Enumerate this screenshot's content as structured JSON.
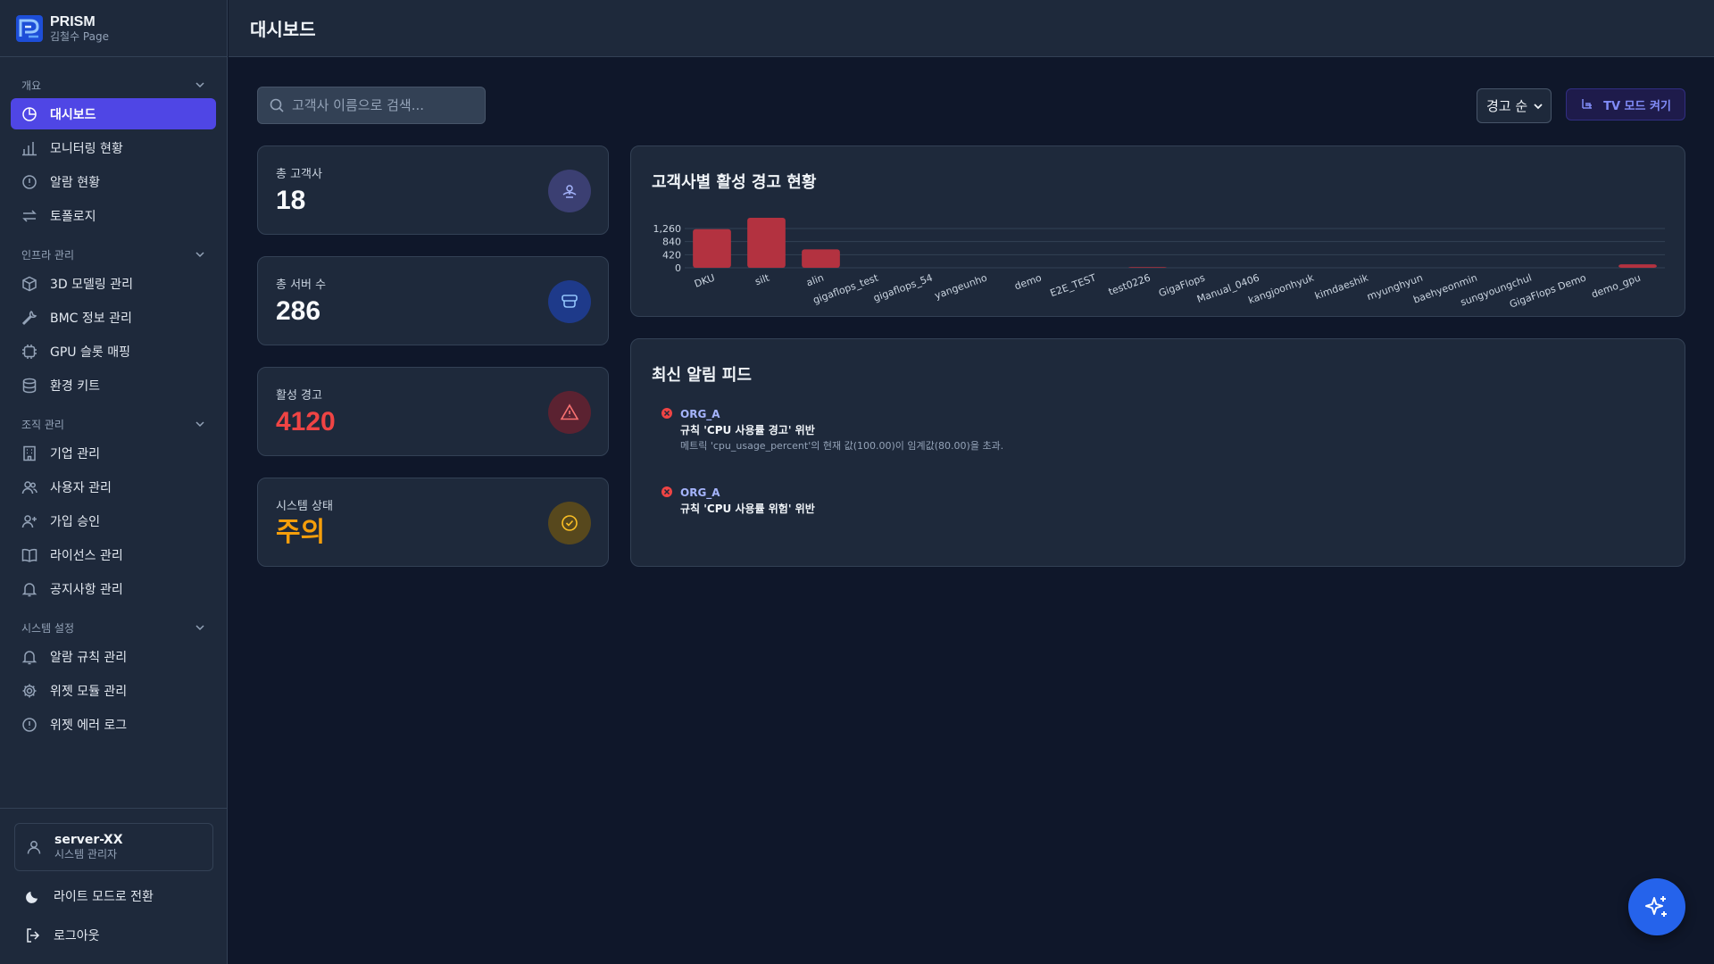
{
  "brand": {
    "title": "PRISM",
    "subtitle": "김철수 Page"
  },
  "sidebar": {
    "sections": [
      {
        "label": "개요",
        "items": [
          {
            "label": "대시보드",
            "icon": "chart-pie-icon",
            "active": true
          },
          {
            "label": "모니터링 현황",
            "icon": "bar-chart-icon"
          },
          {
            "label": "알람 현황",
            "icon": "alert-circle-icon"
          },
          {
            "label": "토폴로지",
            "icon": "arrows-swap-icon"
          }
        ]
      },
      {
        "label": "인프라 관리",
        "items": [
          {
            "label": "3D 모델링 관리",
            "icon": "cube-icon"
          },
          {
            "label": "BMC 정보 관리",
            "icon": "wrench-icon"
          },
          {
            "label": "GPU 슬롯 매핑",
            "icon": "chip-icon"
          },
          {
            "label": "환경 키트",
            "icon": "database-icon"
          }
        ]
      },
      {
        "label": "조직 관리",
        "items": [
          {
            "label": "기업 관리",
            "icon": "building-icon"
          },
          {
            "label": "사용자 관리",
            "icon": "users-icon"
          },
          {
            "label": "가입 승인",
            "icon": "user-plus-icon"
          },
          {
            "label": "라이선스 관리",
            "icon": "book-icon"
          },
          {
            "label": "공지사항 관리",
            "icon": "bell-icon"
          }
        ]
      },
      {
        "label": "시스템 설정",
        "items": [
          {
            "label": "알람 규칙 관리",
            "icon": "bell-icon"
          },
          {
            "label": "위젯 모듈 관리",
            "icon": "gear-icon"
          },
          {
            "label": "위젯 에러 로그",
            "icon": "alert-circle-icon"
          }
        ]
      }
    ]
  },
  "user": {
    "name": "server-XX",
    "role": "시스템 관리자"
  },
  "bottom": {
    "theme_label": "라이트 모드로 전환",
    "logout_label": "로그아웃"
  },
  "header": {
    "title": "대시보드"
  },
  "toolbar": {
    "search_placeholder": "고객사 이름으로 검색...",
    "sort_label": "경고 순",
    "tv_label": "TV 모드 켜기"
  },
  "stats": [
    {
      "label": "총 고객사",
      "value": "18",
      "icon": "satellite-icon",
      "value_color": "#f8fafc",
      "icon_bg": "#3b3f72",
      "icon_color": "#a5b4fc"
    },
    {
      "label": "총 서버 수",
      "value": "286",
      "icon": "server-icon",
      "value_color": "#f8fafc",
      "icon_bg": "#1e3a8a",
      "icon_color": "#93c5fd"
    },
    {
      "label": "활성 경고",
      "value": "4120",
      "icon": "warning-triangle-icon",
      "value_color": "#ef4444",
      "icon_bg": "#5b2231",
      "icon_color": "#f87171"
    },
    {
      "label": "시스템 상태",
      "value": "주의",
      "icon": "check-circle-icon",
      "value_color": "#f59e0b",
      "icon_bg": "#57481d",
      "icon_color": "#fbbf24"
    }
  ],
  "chart_panel": {
    "title": "고객사별 활성 경고 현황"
  },
  "feed_panel": {
    "title": "최신 알림 피드",
    "items": [
      {
        "org": "ORG_A",
        "rule": "규칙 'CPU 사용률 경고' 위반",
        "message": "메트릭 'cpu_usage_percent'의 현재 값(100.00)이 임계값(80.00)을 초과."
      },
      {
        "org": "ORG_A",
        "rule": "규칙 'CPU 사용률 위험' 위반",
        "message": ""
      }
    ]
  },
  "colors": {
    "accent": "#4f46e5",
    "bar": "#b33240",
    "fab": "#2563eb"
  },
  "chart_data": {
    "type": "bar",
    "categories": [
      "DKU",
      "silt",
      "alin",
      "gigaflops_test",
      "gigaflops_54",
      "yangeunho",
      "demo",
      "E2E_TEST",
      "test0226",
      "GigaFlops",
      "Manual_0406",
      "kangjoonhyuk",
      "kimdaeshik",
      "myunghyun",
      "baehyeonmin",
      "sungyoungchul",
      "GigaFlops Demo",
      "demo_gpu"
    ],
    "values": [
      1240,
      1630,
      590,
      0,
      0,
      0,
      0,
      0,
      20,
      0,
      0,
      0,
      0,
      0,
      0,
      0,
      0,
      110
    ],
    "ylim": [
      0,
      1260
    ],
    "yticks": [
      0,
      420,
      840,
      1260
    ],
    "ytick_labels": [
      "0",
      "420",
      "840",
      "1,260"
    ],
    "grid": true,
    "legend": "none"
  }
}
